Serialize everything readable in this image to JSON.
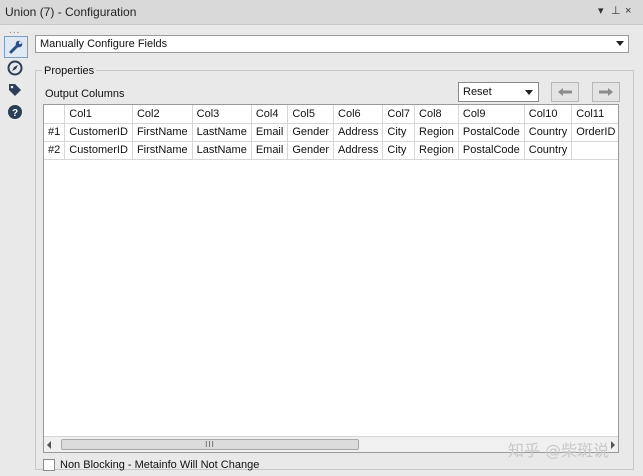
{
  "window": {
    "title": "Union (7) - Configuration",
    "controls": [
      "▾",
      "⊥",
      "×"
    ]
  },
  "rail": {
    "dots": "...",
    "icons": [
      "wrench-icon",
      "compass-icon",
      "tag-icon",
      "help-icon"
    ]
  },
  "config_mode": {
    "value": "Manually Configure Fields"
  },
  "properties": {
    "group_label": "Properties",
    "output_label": "Output Columns",
    "reset": {
      "value": "Reset"
    }
  },
  "grid": {
    "headers": [
      "",
      "Col1",
      "Col2",
      "Col3",
      "Col4",
      "Col5",
      "Col6",
      "Col7",
      "Col8",
      "Col9",
      "Col10",
      "Col11"
    ],
    "rows": [
      [
        "#1",
        "CustomerID",
        "FirstName",
        "LastName",
        "Email",
        "Gender",
        "Address",
        "City",
        "Region",
        "PostalCode",
        "Country",
        "OrderID"
      ],
      [
        "#2",
        "CustomerID",
        "FirstName",
        "LastName",
        "Email",
        "Gender",
        "Address",
        "City",
        "Region",
        "PostalCode",
        "Country",
        ""
      ]
    ]
  },
  "scrollbar": {
    "thumb_grip": "III"
  },
  "non_blocking": {
    "label": "Non Blocking - Metainfo Will Not Change",
    "checked": false
  },
  "watermark": "知乎 @柴斑说"
}
